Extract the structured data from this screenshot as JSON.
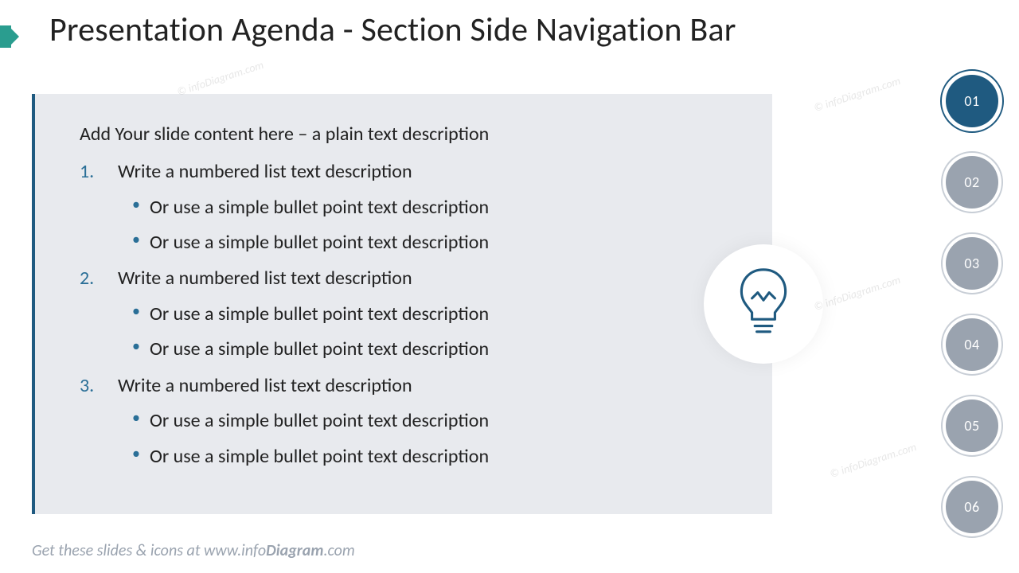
{
  "title": "Presentation Agenda - Section Side Navigation Bar",
  "content": {
    "intro": "Add Your slide content here – a plain text description",
    "items": [
      {
        "label": "Write a numbered list text description",
        "bullets": [
          "Or use a simple bullet point text description",
          "Or use a simple bullet point text description"
        ]
      },
      {
        "label": "Write a numbered list text description",
        "bullets": [
          "Or use a simple bullet point text description",
          "Or use a simple bullet point text description"
        ]
      },
      {
        "label": "Write a numbered list text description",
        "bullets": [
          "Or use a simple bullet point text description",
          "Or use a simple bullet point text description"
        ]
      }
    ]
  },
  "nav": {
    "active_index": 0,
    "items": [
      "01",
      "02",
      "03",
      "04",
      "05",
      "06"
    ]
  },
  "footer": {
    "prefix": "Get these slides & icons at www.",
    "brand_bold_1": "info",
    "brand_bold_2": "Diagram",
    "suffix": ".com"
  },
  "watermark": "© infoDiagram.com",
  "colors": {
    "accent_teal": "#2a9d8f",
    "accent_blue": "#1f5a80",
    "box_bg": "#e8eaee",
    "dot_inactive": "#9aa3af"
  }
}
